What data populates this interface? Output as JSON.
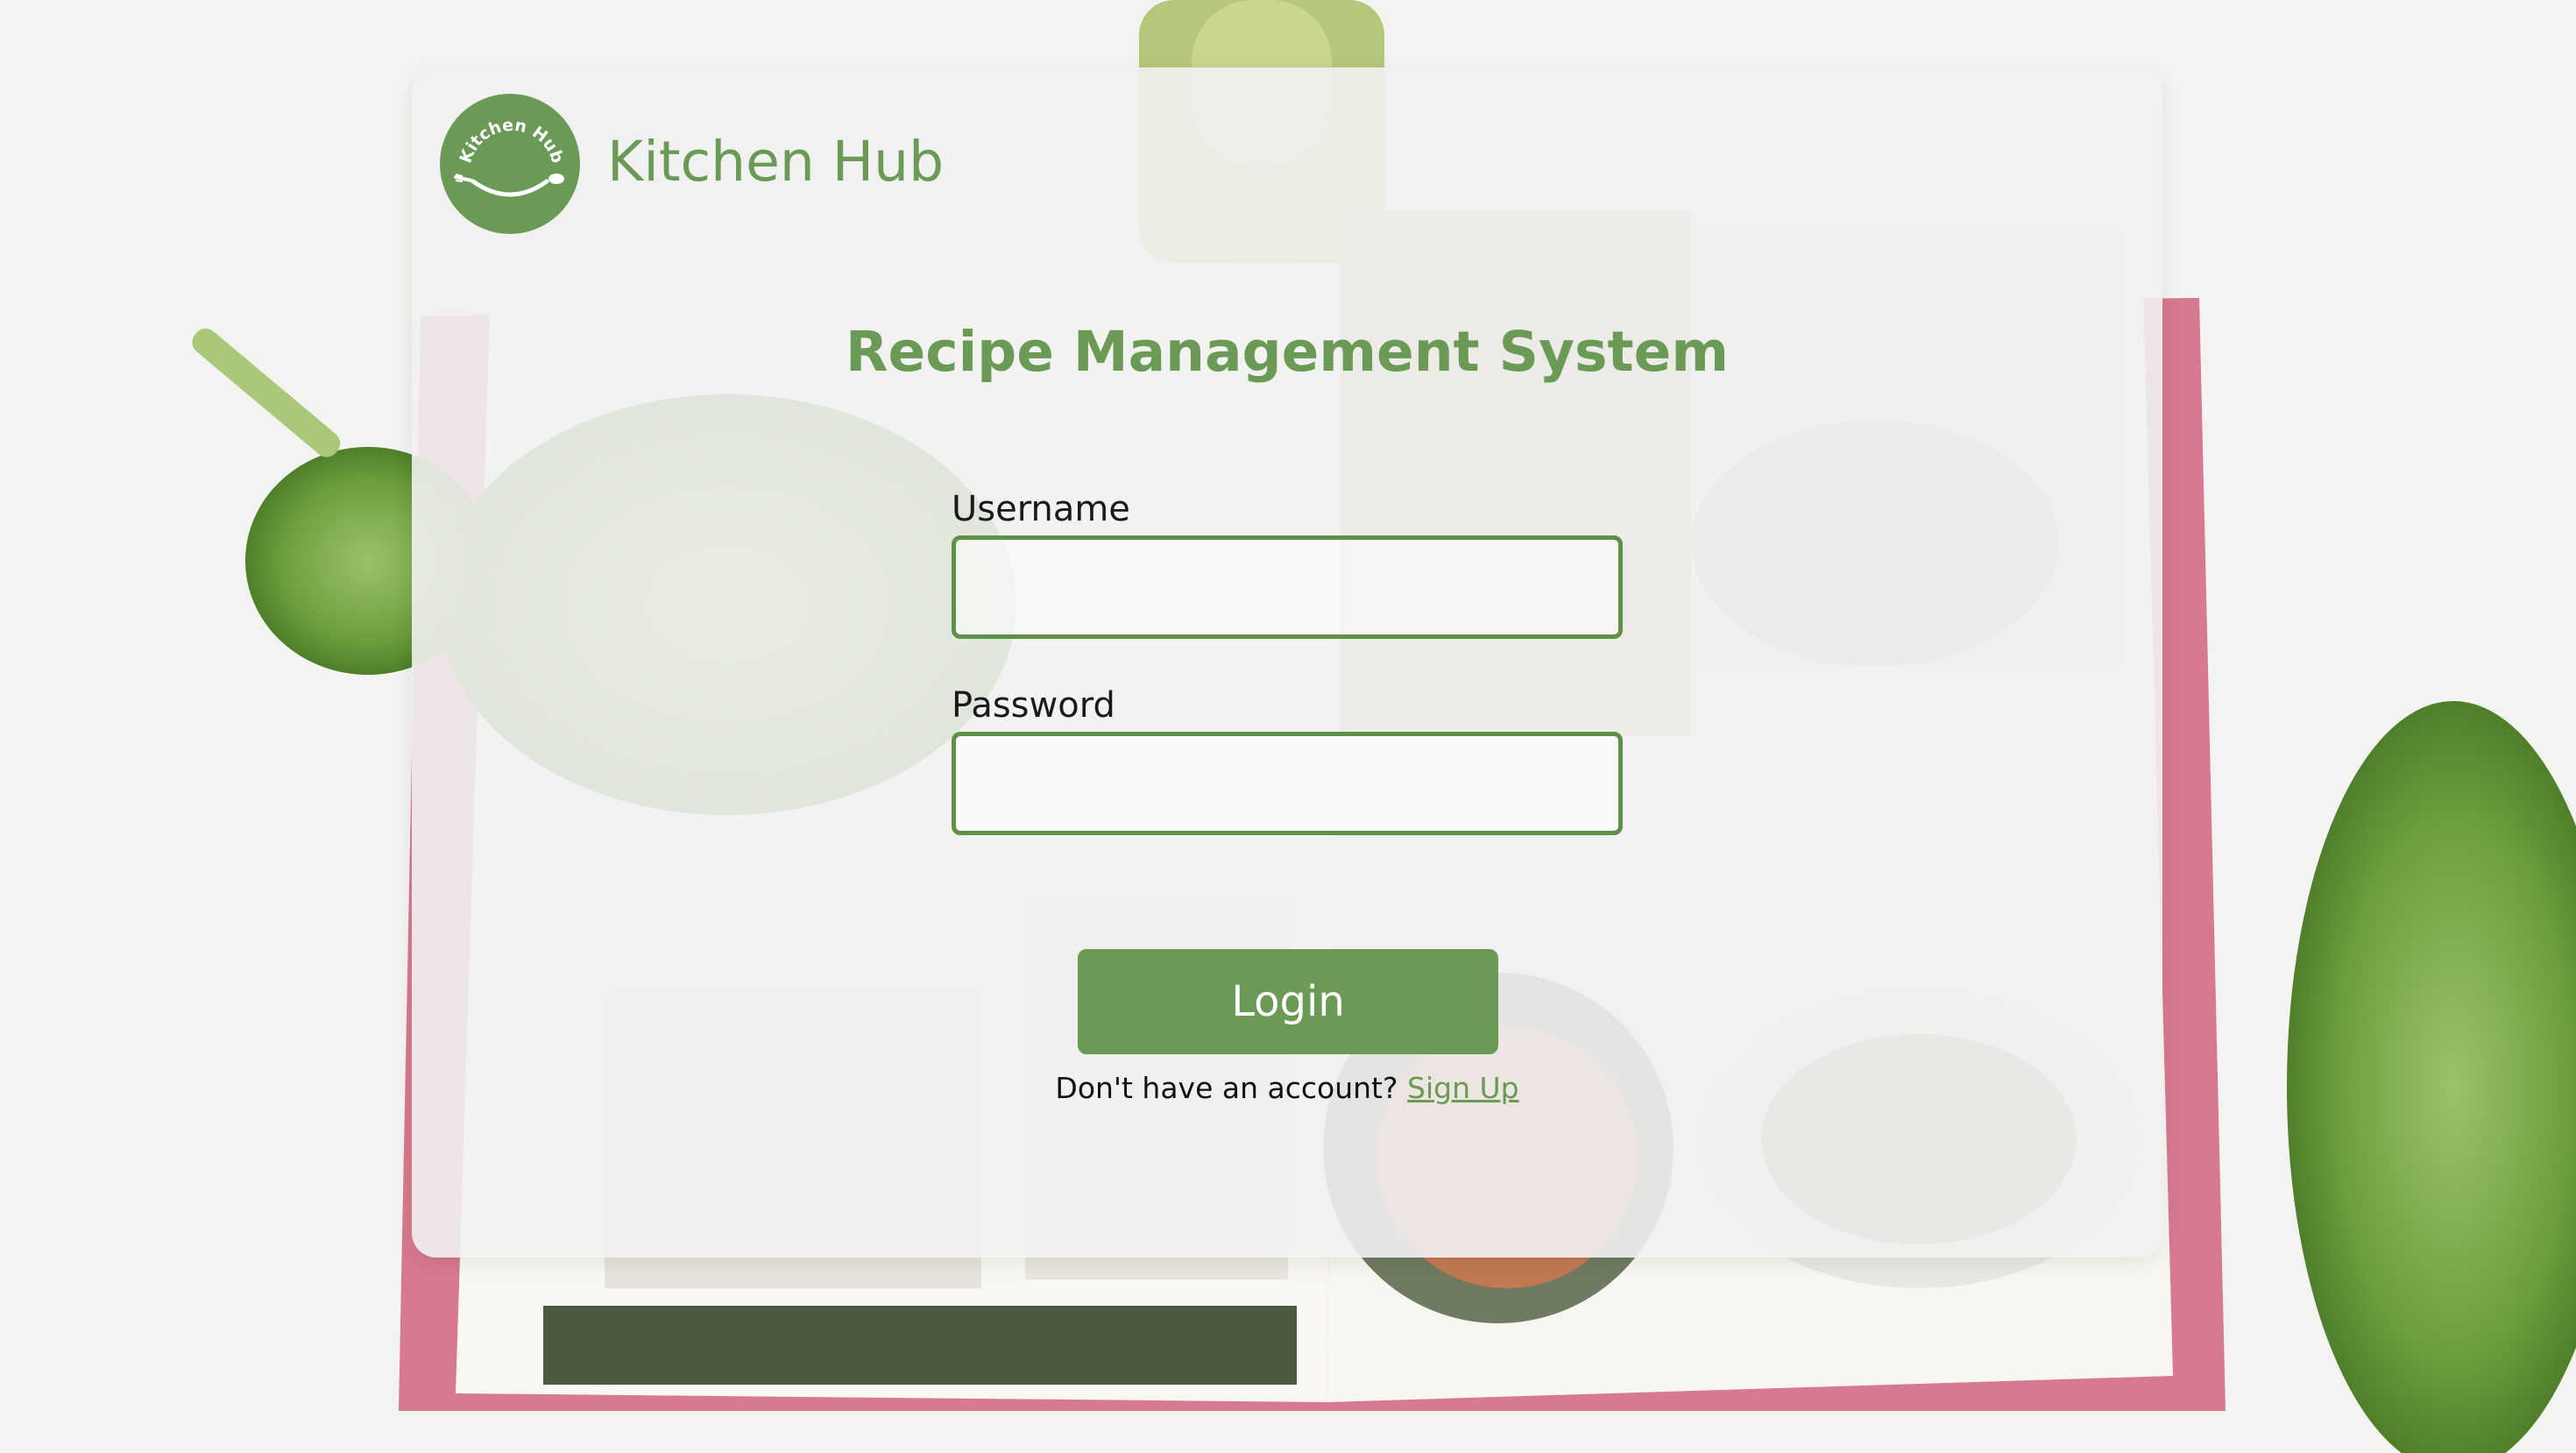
{
  "brand": {
    "logo_text": "Kitchen Hub",
    "name": "Kitchen Hub"
  },
  "page": {
    "title": "Recipe Management System"
  },
  "form": {
    "username_label": "Username",
    "username_value": "",
    "password_label": "Password",
    "password_value": "",
    "login_label": "Login",
    "signup_prompt": "Don't have an account?",
    "signup_link": "Sign Up"
  },
  "colors": {
    "accent": "#6a9a55",
    "input_border": "#5e9147",
    "card_background": "#f1f1f1",
    "page_background": "#f4f4f2"
  },
  "icons": {
    "logo": "fork-and-spoon-icon"
  }
}
